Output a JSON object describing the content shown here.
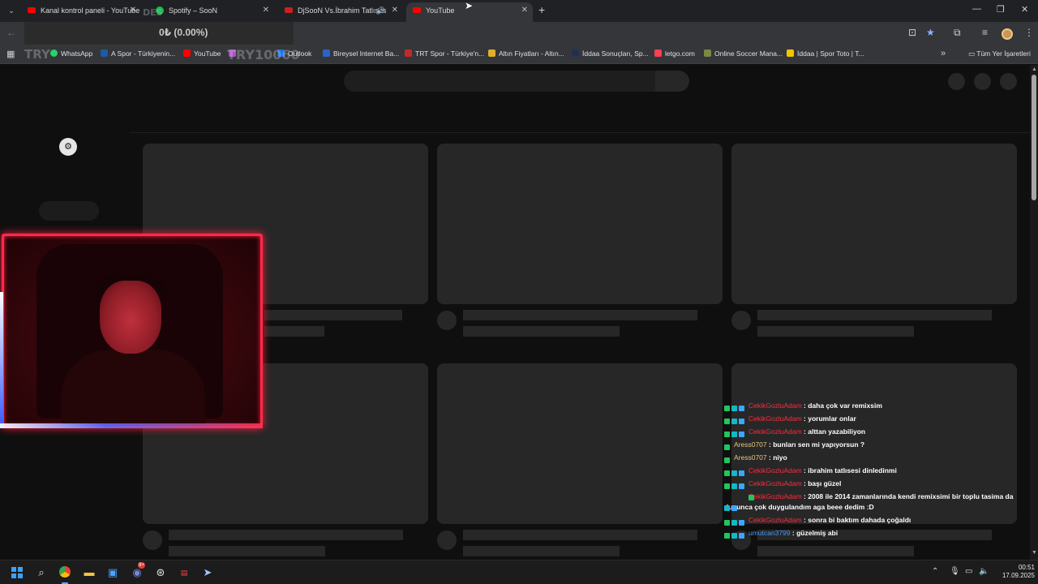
{
  "browser": {
    "tabs": [
      {
        "title": "Kanal kontrol paneli - YouTube",
        "favicon_color": "#ff0000"
      },
      {
        "title": "Spotify – SooN",
        "favicon_color": "#1db954"
      },
      {
        "title": "DjSooN Vs.İbrahim Tatlıses",
        "favicon_color": "#cc2020"
      },
      {
        "title": "YouTube",
        "favicon_color": "#ff0000"
      }
    ],
    "active_tab_index": 3,
    "new_tab_label": "+",
    "close_glyph": "✕",
    "audio_glyph": "🔊",
    "window_controls": {
      "minimize": "—",
      "maximize": "❐",
      "close": "✕"
    },
    "omnibox_text": "0₺ (0.00%)",
    "toolbar_icons": [
      "install-app-icon",
      "bookmark-star-icon",
      "extensions-icon",
      "media-control-icon",
      "profile-avatar-icon",
      "kebab-menu-icon"
    ]
  },
  "bookmarks": {
    "items": [
      {
        "label": "WhatsApp",
        "color": "#25d366"
      },
      {
        "label": "A Spor - Türkiyenin...",
        "color": "#1a5aa6"
      },
      {
        "label": "YouTube",
        "color": "#ff0000"
      },
      {
        "label": "Haberler",
        "color": "#b04fcf"
      },
      {
        "label": "Outlook",
        "color": "#1a73e8"
      },
      {
        "label": "Bireysel Internet Ba...",
        "color": "#2a63c9"
      },
      {
        "label": "TRT Spor - Türkiye'n...",
        "color": "#c42a2a"
      },
      {
        "label": "Altın Fiyatları - Altın...",
        "color": "#e0b02a"
      },
      {
        "label": "İddaa Sonuçları, Sp...",
        "color": "#1f2f5a"
      },
      {
        "label": "letgo.com",
        "color": "#ff3f55"
      },
      {
        "label": "Online Soccer Mana...",
        "color": "#7a8a44"
      },
      {
        "label": "İddaa | Spor Toto | T...",
        "color": "#f3c400"
      }
    ],
    "all_bookmarks_label": "Tüm Yer İşaretleri"
  },
  "overlay": {
    "watermark_left": "TRY",
    "watermark_mid": "TRY10060",
    "watermark_tab": "DES"
  },
  "chat": {
    "messages": [
      {
        "user": "CekikGozluAdam",
        "text": ": daha çok var remixsim",
        "user_color": "#ff2b3c",
        "badges": 3
      },
      {
        "user": "CekikGozluAdam",
        "text": ": yorumlar onlar",
        "user_color": "#ff2b3c",
        "badges": 3
      },
      {
        "user": "CekikGozluAdam",
        "text": ": alttan yazabiliyon",
        "user_color": "#ff2b3c",
        "badges": 3
      },
      {
        "user": "Aress0707",
        "text": ": bunları sen mi yapıyorsun ?",
        "user_color": "#e6c77a",
        "badges": 1
      },
      {
        "user": "Aress0707",
        "text": ": niyo",
        "user_color": "#e6c77a",
        "badges": 1
      },
      {
        "user": "CekikGozluAdam",
        "text": ": ibrahim tatlısesi dinledinmi",
        "user_color": "#ff2b3c",
        "badges": 3
      },
      {
        "user": "CekikGozluAdam",
        "text": ": başı güzel",
        "user_color": "#ff2b3c",
        "badges": 3
      },
      {
        "user": "CekikGozluAdam",
        "text": ": 2008 ile 2014 zamanlarında kendi remixsimi bir toplu tasima da duyunca çok duygulandım aga beee dedim :D",
        "user_color": "#ff2b3c",
        "badges": 3
      },
      {
        "user": "CekikGozluAdam",
        "text": ": sonra bi baktım dahada çoğaldı",
        "user_color": "#ff2b3c",
        "badges": 3
      },
      {
        "user": "umutcan3799",
        "text": ": güzelmiş abi",
        "user_color": "#3d9bff",
        "badges": 3
      }
    ],
    "badge_colors": [
      "#22c55e",
      "#14b8c4",
      "#3ba7ff"
    ]
  },
  "taskbar": {
    "apps": [
      "search-icon",
      "chrome-icon",
      "file-explorer-icon",
      "store-icon",
      "discord-icon",
      "steam-icon",
      "game-app-icon",
      "steam-client-icon"
    ],
    "time": "00:51",
    "date": "17.09.2025",
    "discord_badge": "9+"
  }
}
